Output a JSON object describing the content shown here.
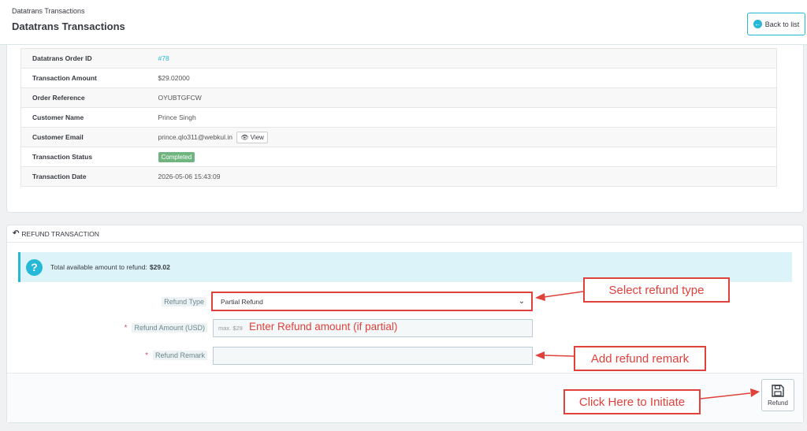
{
  "header": {
    "breadcrumb": "Datatrans Transactions",
    "title": "Datatrans Transactions",
    "back_label": "Back to list"
  },
  "details": {
    "rows": [
      {
        "label": "Datatrans Order ID",
        "value": "#78"
      },
      {
        "label": "Transaction Amount",
        "value": "$29.02000"
      },
      {
        "label": "Order Reference",
        "value": "OYUBTGFCW"
      },
      {
        "label": "Customer Name",
        "value": "Prince Singh"
      },
      {
        "label": "Customer Email",
        "value": "prince.qlo311@webkul.in",
        "action": "View"
      },
      {
        "label": "Transaction Status",
        "value": "Completed"
      },
      {
        "label": "Transaction Date",
        "value": "2026-05-06 15:43:09"
      }
    ]
  },
  "refund": {
    "panel_title": "REFUND TRANSACTION",
    "info_text": "Total available amount to refund:",
    "info_amount": "$29.02",
    "type_label": "Refund Type",
    "type_value": "Partial Refund",
    "amount_label": "Refund Amount (USD)",
    "amount_placeholder": "max. $29",
    "remark_label": "Refund Remark",
    "remark_value": "",
    "button_label": "Refund"
  },
  "annotations": {
    "select_type": "Select refund type",
    "enter_amount": "Enter Refund amount (if partial)",
    "add_remark": "Add refund remark",
    "click_initiate": "Click Here to Initiate"
  },
  "colors": {
    "accent": "#25b9d7",
    "annotation": "#e0413b",
    "status_success": "#70b580"
  }
}
